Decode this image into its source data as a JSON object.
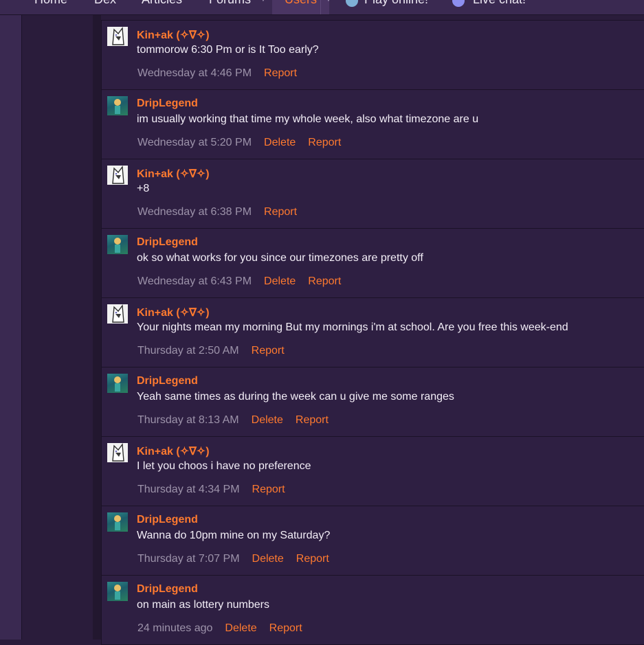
{
  "nav": {
    "items": [
      {
        "label": "Home"
      },
      {
        "label": "Dex"
      },
      {
        "label": "Articles"
      },
      {
        "label": "Forums"
      },
      {
        "label": "Users"
      },
      {
        "label": "Play online!"
      },
      {
        "label": "Live chat!"
      }
    ]
  },
  "actions": {
    "delete": "Delete",
    "report": "Report"
  },
  "messages": [
    {
      "author": "Kin+ak (✧∇✧)",
      "text": "tommorow 6:30 Pm or is It Too early?",
      "time": "Wednesday at 4:46 PM",
      "own": false
    },
    {
      "author": "DripLegend",
      "text": "im usually working that time my whole week, also what timezone are u",
      "time": "Wednesday at 5:20 PM",
      "own": true
    },
    {
      "author": "Kin+ak (✧∇✧)",
      "text": "+8",
      "time": "Wednesday at 6:38 PM",
      "own": false
    },
    {
      "author": "DripLegend",
      "text": "ok so what works for you since our timezones are pretty off",
      "time": "Wednesday at 6:43 PM",
      "own": true
    },
    {
      "author": "Kin+ak (✧∇✧)",
      "text": "Your nights mean my morning But my mornings i'm at school. Are you free this week-end",
      "time": "Thursday at 2:50 AM",
      "own": false
    },
    {
      "author": "DripLegend",
      "text": "Yeah same times as during the week can u give me some ranges",
      "time": "Thursday at 8:13 AM",
      "own": true
    },
    {
      "author": "Kin+ak (✧∇✧)",
      "text": "I let you choos i have no preference",
      "time": "Thursday at 4:34 PM",
      "own": false
    },
    {
      "author": "DripLegend",
      "text": "Wanna do 10pm mine on my Saturday?",
      "time": "Thursday at 7:07 PM",
      "own": true
    },
    {
      "author": "DripLegend",
      "text": "on main as lottery numbers",
      "time": "24 minutes ago",
      "own": true
    }
  ],
  "colors": {
    "accent": "#ff7a2f",
    "background": "#2a1c3b",
    "card": "#2e1f42",
    "text": "#f3eef7",
    "muted": "#9d93aa"
  }
}
